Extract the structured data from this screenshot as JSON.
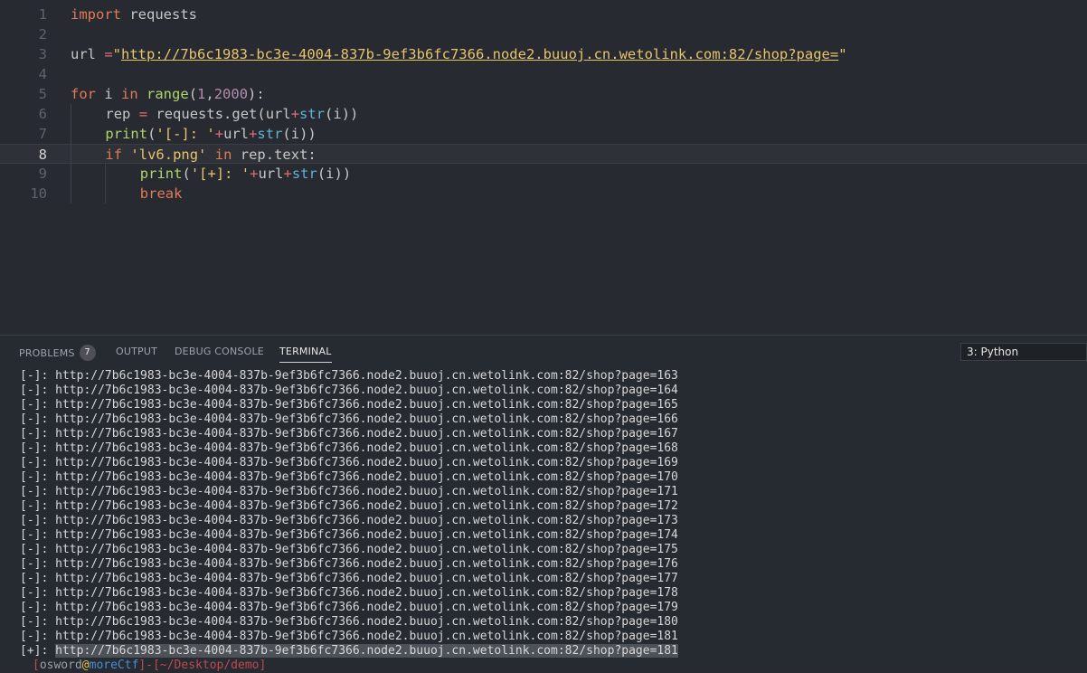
{
  "editor": {
    "lines": [
      {
        "num": "1",
        "tokens": [
          {
            "t": "import",
            "c": "kw"
          },
          {
            "t": " requests",
            "c": ""
          }
        ]
      },
      {
        "num": "2",
        "tokens": []
      },
      {
        "num": "3",
        "tokens": [
          {
            "t": "url ",
            "c": ""
          },
          {
            "t": "=",
            "c": "op"
          },
          {
            "t": "\"",
            "c": "str"
          },
          {
            "t": "http://7b6c1983-bc3e-4004-837b-9ef3b6fc7366.node2.buuoj.cn.wetolink.com:82/shop?page=",
            "c": "url"
          },
          {
            "t": "\"",
            "c": "str"
          }
        ]
      },
      {
        "num": "4",
        "tokens": []
      },
      {
        "num": "5",
        "tokens": [
          {
            "t": "for",
            "c": "kw"
          },
          {
            "t": " i ",
            "c": ""
          },
          {
            "t": "in",
            "c": "kw"
          },
          {
            "t": " ",
            "c": ""
          },
          {
            "t": "range",
            "c": "bi"
          },
          {
            "t": "(",
            "c": ""
          },
          {
            "t": "1",
            "c": "num"
          },
          {
            "t": ",",
            "c": ""
          },
          {
            "t": "2000",
            "c": "num"
          },
          {
            "t": "):",
            "c": ""
          }
        ]
      },
      {
        "num": "6",
        "indent": 1,
        "tokens": [
          {
            "t": "rep ",
            "c": ""
          },
          {
            "t": "=",
            "c": "op"
          },
          {
            "t": " requests.get(url",
            "c": ""
          },
          {
            "t": "+",
            "c": "op"
          },
          {
            "t": "str",
            "c": "fn"
          },
          {
            "t": "(i))",
            "c": ""
          }
        ]
      },
      {
        "num": "7",
        "indent": 1,
        "tokens": [
          {
            "t": "print",
            "c": "bi"
          },
          {
            "t": "(",
            "c": ""
          },
          {
            "t": "'[-]: '",
            "c": "str"
          },
          {
            "t": "+",
            "c": "op"
          },
          {
            "t": "url",
            "c": ""
          },
          {
            "t": "+",
            "c": "op"
          },
          {
            "t": "str",
            "c": "fn"
          },
          {
            "t": "(i))",
            "c": ""
          }
        ]
      },
      {
        "num": "8",
        "indent": 1,
        "active": true,
        "tokens": [
          {
            "t": "if",
            "c": "kw"
          },
          {
            "t": " ",
            "c": ""
          },
          {
            "t": "'lv6.png'",
            "c": "str"
          },
          {
            "t": " ",
            "c": ""
          },
          {
            "t": "in",
            "c": "kw"
          },
          {
            "t": " rep.text:",
            "c": ""
          }
        ]
      },
      {
        "num": "9",
        "indent": 2,
        "tokens": [
          {
            "t": "print",
            "c": "bi"
          },
          {
            "t": "(",
            "c": ""
          },
          {
            "t": "'[+]: '",
            "c": "str"
          },
          {
            "t": "+",
            "c": "op"
          },
          {
            "t": "url",
            "c": ""
          },
          {
            "t": "+",
            "c": "op"
          },
          {
            "t": "str",
            "c": "fn"
          },
          {
            "t": "(i))",
            "c": ""
          }
        ]
      },
      {
        "num": "10",
        "indent": 2,
        "tokens": [
          {
            "t": "break",
            "c": "kw"
          }
        ]
      }
    ]
  },
  "panel": {
    "tabs": {
      "problems": "PROBLEMS",
      "problems_count": "7",
      "output": "OUTPUT",
      "debug": "DEBUG CONSOLE",
      "terminal": "TERMINAL"
    },
    "terminal_select": "3: Python"
  },
  "terminal": {
    "lines": [
      "[-]: http://7b6c1983-bc3e-4004-837b-9ef3b6fc7366.node2.buuoj.cn.wetolink.com:82/shop?page=163",
      "[-]: http://7b6c1983-bc3e-4004-837b-9ef3b6fc7366.node2.buuoj.cn.wetolink.com:82/shop?page=164",
      "[-]: http://7b6c1983-bc3e-4004-837b-9ef3b6fc7366.node2.buuoj.cn.wetolink.com:82/shop?page=165",
      "[-]: http://7b6c1983-bc3e-4004-837b-9ef3b6fc7366.node2.buuoj.cn.wetolink.com:82/shop?page=166",
      "[-]: http://7b6c1983-bc3e-4004-837b-9ef3b6fc7366.node2.buuoj.cn.wetolink.com:82/shop?page=167",
      "[-]: http://7b6c1983-bc3e-4004-837b-9ef3b6fc7366.node2.buuoj.cn.wetolink.com:82/shop?page=168",
      "[-]: http://7b6c1983-bc3e-4004-837b-9ef3b6fc7366.node2.buuoj.cn.wetolink.com:82/shop?page=169",
      "[-]: http://7b6c1983-bc3e-4004-837b-9ef3b6fc7366.node2.buuoj.cn.wetolink.com:82/shop?page=170",
      "[-]: http://7b6c1983-bc3e-4004-837b-9ef3b6fc7366.node2.buuoj.cn.wetolink.com:82/shop?page=171",
      "[-]: http://7b6c1983-bc3e-4004-837b-9ef3b6fc7366.node2.buuoj.cn.wetolink.com:82/shop?page=172",
      "[-]: http://7b6c1983-bc3e-4004-837b-9ef3b6fc7366.node2.buuoj.cn.wetolink.com:82/shop?page=173",
      "[-]: http://7b6c1983-bc3e-4004-837b-9ef3b6fc7366.node2.buuoj.cn.wetolink.com:82/shop?page=174",
      "[-]: http://7b6c1983-bc3e-4004-837b-9ef3b6fc7366.node2.buuoj.cn.wetolink.com:82/shop?page=175",
      "[-]: http://7b6c1983-bc3e-4004-837b-9ef3b6fc7366.node2.buuoj.cn.wetolink.com:82/shop?page=176",
      "[-]: http://7b6c1983-bc3e-4004-837b-9ef3b6fc7366.node2.buuoj.cn.wetolink.com:82/shop?page=177",
      "[-]: http://7b6c1983-bc3e-4004-837b-9ef3b6fc7366.node2.buuoj.cn.wetolink.com:82/shop?page=178",
      "[-]: http://7b6c1983-bc3e-4004-837b-9ef3b6fc7366.node2.buuoj.cn.wetolink.com:82/shop?page=179",
      "[-]: http://7b6c1983-bc3e-4004-837b-9ef3b6fc7366.node2.buuoj.cn.wetolink.com:82/shop?page=180",
      "[-]: http://7b6c1983-bc3e-4004-837b-9ef3b6fc7366.node2.buuoj.cn.wetolink.com:82/shop?page=181"
    ],
    "result_prefix": "[+]: ",
    "result_url": "http://7b6c1983-bc3e-4004-837b-9ef3b6fc7366.node2.buuoj.cn.wetolink.com:82/shop?page=181",
    "prompt": {
      "open": "[",
      "user": "osword",
      "at": "@",
      "host": "moreCtf",
      "mid": "]-[",
      "path": "~/Desktop/demo",
      "close": "]"
    }
  }
}
